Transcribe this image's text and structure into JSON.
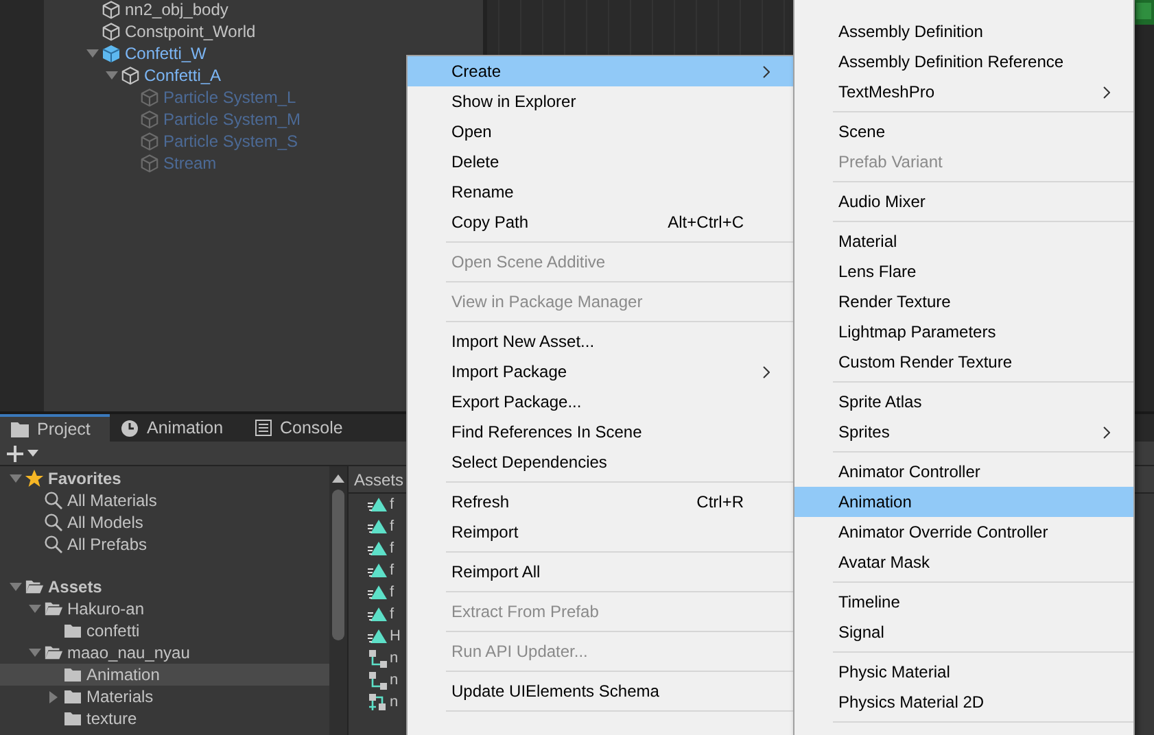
{
  "hierarchy": {
    "items": [
      {
        "label": "nn2_obj_body",
        "kind": "object",
        "active": true
      },
      {
        "label": "Constpoint_World",
        "kind": "object",
        "active": true
      },
      {
        "label": "Confetti_W",
        "kind": "prefab_root",
        "active": true,
        "expanded": true,
        "children": [
          {
            "label": "Confetti_A",
            "kind": "prefab",
            "active": true,
            "expanded": true,
            "children": [
              {
                "label": "Particle System_L",
                "kind": "prefab",
                "active": false
              },
              {
                "label": "Particle System_M",
                "kind": "prefab",
                "active": false
              },
              {
                "label": "Particle System_S",
                "kind": "prefab",
                "active": false
              },
              {
                "label": "Stream",
                "kind": "prefab",
                "active": false
              }
            ]
          }
        ]
      }
    ]
  },
  "panel_tabs": [
    {
      "label": "Project",
      "kind": "project",
      "selected": true
    },
    {
      "label": "Animation",
      "kind": "animation",
      "selected": false
    },
    {
      "label": "Console",
      "kind": "console",
      "selected": false
    }
  ],
  "project": {
    "tree": [
      {
        "label": "Favorites",
        "kind": "favorites",
        "selected": false,
        "expanded": true,
        "children": [
          {
            "label": "All Materials",
            "kind": "search",
            "selected": false
          },
          {
            "label": "All Models",
            "kind": "search",
            "selected": false
          },
          {
            "label": "All Prefabs",
            "kind": "search",
            "selected": false
          }
        ]
      },
      {
        "label": "Assets",
        "kind": "root_folder",
        "selected": false,
        "expanded": true,
        "children": [
          {
            "label": "Hakuro-an",
            "kind": "folder",
            "selected": false,
            "expanded": true,
            "children": [
              {
                "label": "confetti",
                "kind": "folder",
                "selected": false
              }
            ]
          },
          {
            "label": "maao_nau_nyau",
            "kind": "folder",
            "selected": false,
            "expanded": true,
            "children": [
              {
                "label": "Animation",
                "kind": "folder",
                "selected": true
              },
              {
                "label": "Materials",
                "kind": "folder",
                "selected": false,
                "expanded": false
              },
              {
                "label": "texture",
                "kind": "folder",
                "selected": false
              }
            ]
          }
        ]
      }
    ],
    "breadcrumb": "Assets",
    "assets": [
      {
        "label": "f",
        "kind": "animation"
      },
      {
        "label": "f",
        "kind": "animation"
      },
      {
        "label": "f",
        "kind": "animation"
      },
      {
        "label": "f",
        "kind": "animation"
      },
      {
        "label": "f",
        "kind": "animation"
      },
      {
        "label": "f",
        "kind": "animation"
      },
      {
        "label": "H",
        "kind": "animation"
      },
      {
        "label": "n",
        "kind": "controller"
      },
      {
        "label": "n",
        "kind": "controller"
      },
      {
        "label": "n",
        "kind": "override_controller"
      }
    ]
  },
  "context_menu": {
    "items": [
      {
        "kind": "item",
        "label": "Create",
        "submenu": true,
        "selected": true,
        "disabled": false
      },
      {
        "kind": "item",
        "label": "Show in Explorer",
        "submenu": false,
        "selected": false,
        "disabled": false
      },
      {
        "kind": "item",
        "label": "Open",
        "submenu": false,
        "selected": false,
        "disabled": false
      },
      {
        "kind": "item",
        "label": "Delete",
        "submenu": false,
        "selected": false,
        "disabled": false
      },
      {
        "kind": "item",
        "label": "Rename",
        "submenu": false,
        "selected": false,
        "disabled": false
      },
      {
        "kind": "item",
        "label": "Copy Path",
        "shortcut": "Alt+Ctrl+C",
        "submenu": false,
        "selected": false,
        "disabled": false
      },
      {
        "kind": "separator"
      },
      {
        "kind": "item",
        "label": "Open Scene Additive",
        "submenu": false,
        "selected": false,
        "disabled": true
      },
      {
        "kind": "separator"
      },
      {
        "kind": "item",
        "label": "View in Package Manager",
        "submenu": false,
        "selected": false,
        "disabled": true
      },
      {
        "kind": "separator"
      },
      {
        "kind": "item",
        "label": "Import New Asset...",
        "submenu": false,
        "selected": false,
        "disabled": false
      },
      {
        "kind": "item",
        "label": "Import Package",
        "submenu": true,
        "selected": false,
        "disabled": false
      },
      {
        "kind": "item",
        "label": "Export Package...",
        "submenu": false,
        "selected": false,
        "disabled": false
      },
      {
        "kind": "item",
        "label": "Find References In Scene",
        "submenu": false,
        "selected": false,
        "disabled": false
      },
      {
        "kind": "item",
        "label": "Select Dependencies",
        "submenu": false,
        "selected": false,
        "disabled": false
      },
      {
        "kind": "separator"
      },
      {
        "kind": "item",
        "label": "Refresh",
        "shortcut": "Ctrl+R",
        "submenu": false,
        "selected": false,
        "disabled": false
      },
      {
        "kind": "item",
        "label": "Reimport",
        "submenu": false,
        "selected": false,
        "disabled": false
      },
      {
        "kind": "separator"
      },
      {
        "kind": "item",
        "label": "Reimport All",
        "submenu": false,
        "selected": false,
        "disabled": false
      },
      {
        "kind": "separator"
      },
      {
        "kind": "item",
        "label": "Extract From Prefab",
        "submenu": false,
        "selected": false,
        "disabled": true
      },
      {
        "kind": "separator"
      },
      {
        "kind": "item",
        "label": "Run API Updater...",
        "submenu": false,
        "selected": false,
        "disabled": true
      },
      {
        "kind": "separator"
      },
      {
        "kind": "item",
        "label": "Update UIElements Schema",
        "submenu": false,
        "selected": false,
        "disabled": false
      },
      {
        "kind": "separator"
      }
    ]
  },
  "create_submenu": {
    "items": [
      {
        "kind": "item",
        "label": "Assembly Definition",
        "submenu": false,
        "selected": false,
        "disabled": false
      },
      {
        "kind": "item",
        "label": "Assembly Definition Reference",
        "submenu": false,
        "selected": false,
        "disabled": false
      },
      {
        "kind": "item",
        "label": "TextMeshPro",
        "submenu": true,
        "selected": false,
        "disabled": false
      },
      {
        "kind": "separator"
      },
      {
        "kind": "item",
        "label": "Scene",
        "submenu": false,
        "selected": false,
        "disabled": false
      },
      {
        "kind": "item",
        "label": "Prefab Variant",
        "submenu": false,
        "selected": false,
        "disabled": true
      },
      {
        "kind": "separator"
      },
      {
        "kind": "item",
        "label": "Audio Mixer",
        "submenu": false,
        "selected": false,
        "disabled": false
      },
      {
        "kind": "separator"
      },
      {
        "kind": "item",
        "label": "Material",
        "submenu": false,
        "selected": false,
        "disabled": false
      },
      {
        "kind": "item",
        "label": "Lens Flare",
        "submenu": false,
        "selected": false,
        "disabled": false
      },
      {
        "kind": "item",
        "label": "Render Texture",
        "submenu": false,
        "selected": false,
        "disabled": false
      },
      {
        "kind": "item",
        "label": "Lightmap Parameters",
        "submenu": false,
        "selected": false,
        "disabled": false
      },
      {
        "kind": "item",
        "label": "Custom Render Texture",
        "submenu": false,
        "selected": false,
        "disabled": false
      },
      {
        "kind": "separator"
      },
      {
        "kind": "item",
        "label": "Sprite Atlas",
        "submenu": false,
        "selected": false,
        "disabled": false
      },
      {
        "kind": "item",
        "label": "Sprites",
        "submenu": true,
        "selected": false,
        "disabled": false
      },
      {
        "kind": "separator"
      },
      {
        "kind": "item",
        "label": "Animator Controller",
        "submenu": false,
        "selected": false,
        "disabled": false
      },
      {
        "kind": "item",
        "label": "Animation",
        "submenu": false,
        "selected": true,
        "disabled": false
      },
      {
        "kind": "item",
        "label": "Animator Override Controller",
        "submenu": false,
        "selected": false,
        "disabled": false
      },
      {
        "kind": "item",
        "label": "Avatar Mask",
        "submenu": false,
        "selected": false,
        "disabled": false
      },
      {
        "kind": "separator"
      },
      {
        "kind": "item",
        "label": "Timeline",
        "submenu": false,
        "selected": false,
        "disabled": false
      },
      {
        "kind": "item",
        "label": "Signal",
        "submenu": false,
        "selected": false,
        "disabled": false
      },
      {
        "kind": "separator"
      },
      {
        "kind": "item",
        "label": "Physic Material",
        "submenu": false,
        "selected": false,
        "disabled": false
      },
      {
        "kind": "item",
        "label": "Physics Material 2D",
        "submenu": false,
        "selected": false,
        "disabled": false
      },
      {
        "kind": "separator"
      }
    ]
  }
}
